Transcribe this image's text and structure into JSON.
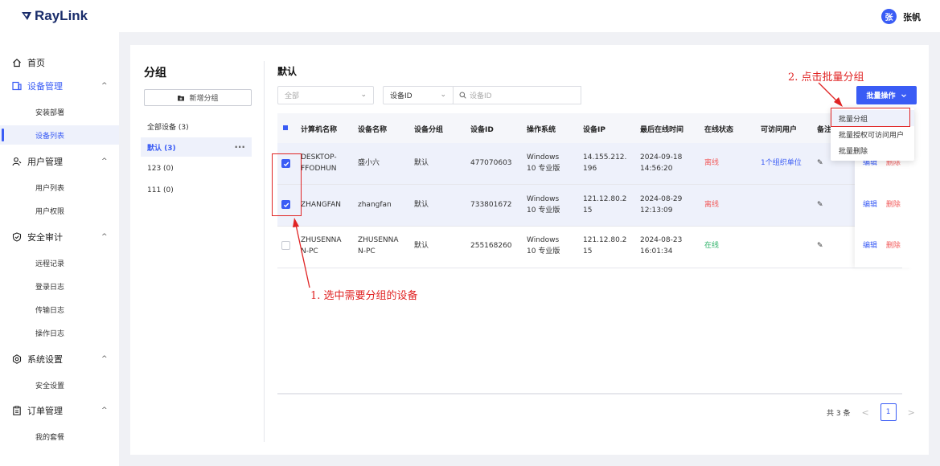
{
  "app": {
    "logo": "RayLink",
    "user_avatar": "张",
    "user_name": "张帆"
  },
  "sidebar": {
    "home": "首页",
    "device_mgmt": "设备管理",
    "device_deploy": "安装部署",
    "device_list": "设备列表",
    "user_mgmt": "用户管理",
    "user_list": "用户列表",
    "user_perm": "用户权限",
    "security_audit": "安全审计",
    "remote_log": "远程记录",
    "login_log": "登录日志",
    "transfer_log": "传输日志",
    "op_log": "操作日志",
    "system_settings": "系统设置",
    "security_settings": "安全设置",
    "order_mgmt": "订单管理",
    "my_plan": "我的套餐",
    "chevron": "^"
  },
  "groups": {
    "title": "分组",
    "new_button": "新增分组",
    "items": [
      "全部设备 (3)",
      "默认 (3)",
      "123 (0)",
      "111 (0)"
    ],
    "more": "···"
  },
  "content": {
    "title": "默认",
    "filter_select": "全部",
    "search_field_select": "设备ID",
    "search_placeholder": "设备ID",
    "bulk_button": "批量操作"
  },
  "dropdown": {
    "items": [
      "批量分组",
      "批量授权可访问用户",
      "批量删除"
    ]
  },
  "table": {
    "headers": [
      "计算机名称",
      "设备名称",
      "设备分组",
      "设备ID",
      "操作系统",
      "设备IP",
      "最后在线时间",
      "在线状态",
      "可访问用户",
      "备注"
    ],
    "rows": [
      {
        "computer": [
          "DESKTOP-",
          "FFODHUN"
        ],
        "device": "盛小六",
        "group": "默认",
        "id": "477070603",
        "os": [
          "Windows",
          "10 专业版"
        ],
        "ip": [
          "14.155.212.",
          "196"
        ],
        "last": [
          "2024-09-18",
          "14:56:20"
        ],
        "status": "离线",
        "access": "1个组织单位",
        "edit": "编辑",
        "delete": "删除"
      },
      {
        "computer": [
          "ZHANGFAN",
          ""
        ],
        "device": "zhangfan",
        "group": "默认",
        "id": "733801672",
        "os": [
          "Windows",
          "10 专业版"
        ],
        "ip": [
          "121.12.80.2",
          "15"
        ],
        "last": [
          "2024-08-29",
          "12:13:09"
        ],
        "status": "离线",
        "access": "",
        "edit": "编辑",
        "delete": "删除"
      },
      {
        "computer": [
          "ZHUSENNA",
          "N-PC"
        ],
        "device": [
          "ZHUSENNA",
          "N-PC"
        ],
        "group": "默认",
        "id": "255168260",
        "os": [
          "Windows",
          "10 专业版"
        ],
        "ip": [
          "121.12.80.2",
          "15"
        ],
        "last": [
          "2024-08-23",
          "16:01:34"
        ],
        "status": "在线",
        "access": "",
        "edit": "编辑",
        "delete": "删除"
      }
    ]
  },
  "pagination": {
    "total": "共 3 条",
    "page": "1",
    "prev": "<",
    "next": ">"
  },
  "annotations": {
    "step1": "1. 选中需要分组的设备",
    "step2": "2. 点击批量分组"
  },
  "colors": {
    "accent": "#3a5cf5",
    "annotation": "#e02424",
    "offline": "#f25b5b",
    "online": "#2fb36a"
  }
}
